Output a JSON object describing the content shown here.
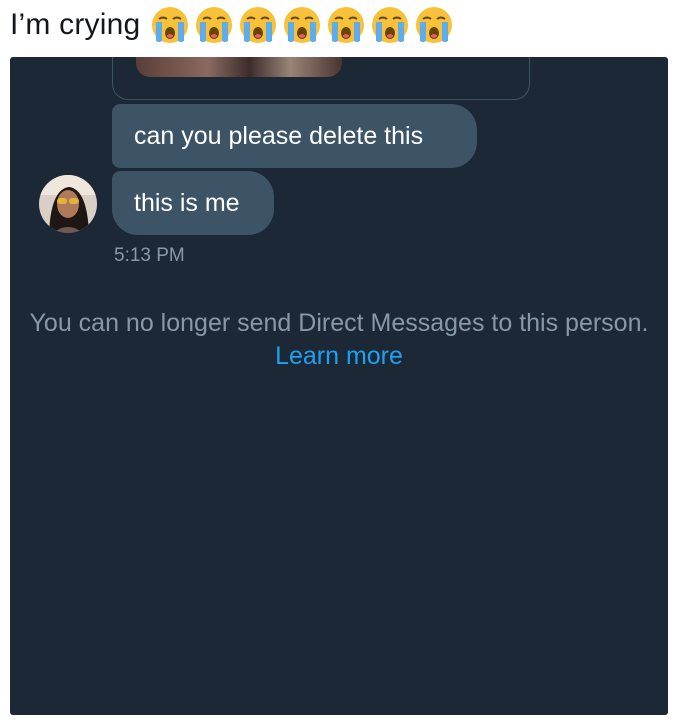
{
  "tweet": {
    "text": "I’m crying",
    "emojis": [
      "loudly-crying-face",
      "loudly-crying-face",
      "loudly-crying-face",
      "loudly-crying-face",
      "loudly-crying-face",
      "loudly-crying-face",
      "loudly-crying-face"
    ]
  },
  "conversation": {
    "messages": [
      {
        "text": "can you please delete this"
      },
      {
        "text": "this is me"
      }
    ],
    "timestamp": "5:13 PM",
    "notice": {
      "text": "You can no longer send Direct Messages to this person.",
      "link": "Learn more"
    }
  },
  "colors": {
    "background": "#1c2836",
    "bubble": "#3d5466",
    "muted_text": "#8899a6",
    "link": "#1da1f2"
  }
}
